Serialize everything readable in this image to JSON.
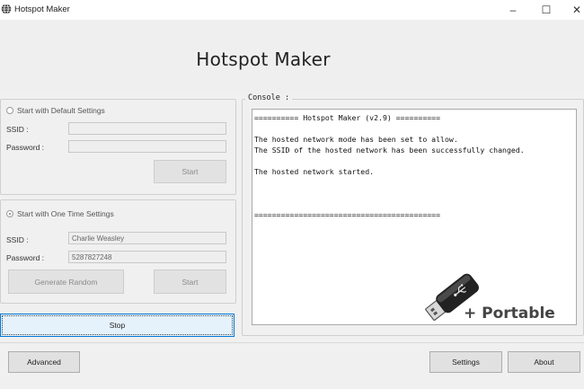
{
  "window": {
    "title": "Hotspot Maker",
    "controls": {
      "minimize": "–",
      "maximize": "☐",
      "close": "✕"
    }
  },
  "header": {
    "title": "Hotspot Maker"
  },
  "default_settings": {
    "radio_label": "Start with Default Settings",
    "selected": false,
    "ssid_label": "SSID :",
    "ssid_value": "",
    "password_label": "Password :",
    "password_value": "",
    "start_label": "Start"
  },
  "one_time_settings": {
    "radio_label": "Start with One Time Settings",
    "selected": true,
    "ssid_label": "SSID :",
    "ssid_value": "Charlie Weasley",
    "password_label": "Password :",
    "password_value": "5287827248",
    "generate_label": "Generate Random",
    "start_label": "Start"
  },
  "stop_label": "Stop",
  "console": {
    "label": "Console :",
    "lines": [
      "========== Hotspot Maker (v2.9) ==========",
      "",
      "The hosted network mode has been set to allow.",
      "The SSID of the hosted network has been successfully changed.",
      "",
      "The hosted network started.",
      "",
      "",
      "",
      "=========================================="
    ]
  },
  "overlay": {
    "portable_text": "+ Portable",
    "icon": "usb-drive-icon"
  },
  "footer": {
    "advanced_label": "Advanced",
    "settings_label": "Settings",
    "about_label": "About"
  },
  "colors": {
    "accent": "#0078d7",
    "background": "#f0f0f0"
  }
}
